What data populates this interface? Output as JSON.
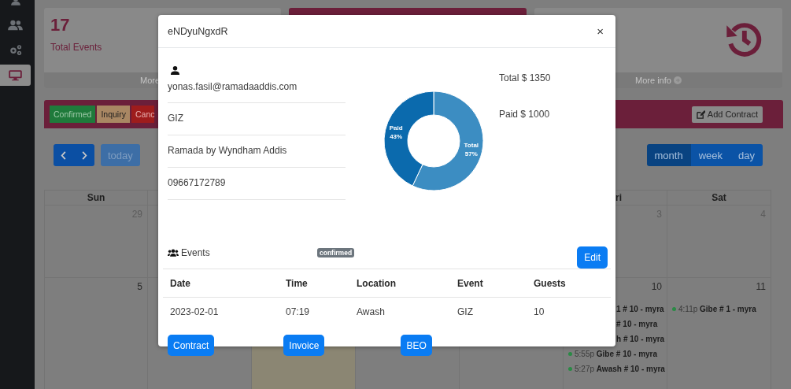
{
  "sidebar": {
    "items": [
      {
        "selected": false
      },
      {
        "selected": false
      },
      {
        "selected": false
      },
      {
        "selected": true
      }
    ]
  },
  "stat_cards": [
    {
      "kind": "count",
      "value": "17",
      "label": "Total Events",
      "footer": "More"
    },
    {
      "kind": "blank"
    },
    {
      "kind": "icon",
      "footer": "More info"
    }
  ],
  "contract_bar": {
    "statuses": [
      {
        "label": "Confirmed",
        "color": "#1f7a3b"
      },
      {
        "label": "Inquiry",
        "color": "#a98763"
      },
      {
        "label": "Canc",
        "color": "#9e1c1c"
      }
    ],
    "add_button": "Add Contract"
  },
  "toolbar": {
    "today": "today",
    "views": [
      {
        "label": "month",
        "selected": true
      },
      {
        "label": "week",
        "selected": false
      },
      {
        "label": "day",
        "selected": false
      }
    ]
  },
  "calendar": {
    "weekdays": [
      {
        "label": "Sun",
        "kind": "full"
      },
      {
        "label": "ri",
        "kind": "cut"
      },
      {
        "label": "Sat",
        "kind": "full"
      }
    ],
    "weeks": [
      [
        {
          "date": "29",
          "today": false
        },
        {
          "date": "3",
          "today": false
        },
        {
          "date": "4",
          "today": false
        }
      ],
      [
        {
          "date": "5",
          "today": false
        },
        {
          "today": false
        },
        {
          "today": true
        },
        {
          "today": false
        },
        {
          "today": false
        },
        {
          "date": "10",
          "today": false,
          "events": [
            {
              "kind": "cut",
              "title": "1 # 10 - myra"
            },
            {
              "kind": "cut",
              "title": "# 10 - myra"
            },
            {
              "kind": "cut",
              "title": "h # 10 - myra"
            },
            {
              "kind": "full",
              "time": "5:55p",
              "title": "Gibe # 10 - myra",
              "color": "#2a8a45"
            },
            {
              "kind": "full",
              "time": "5:27p",
              "title": "Awash # 10 - myra",
              "color": "#2a8a45"
            }
          ]
        },
        {
          "date": "11",
          "today": false,
          "events": [
            {
              "kind": "full",
              "time": "4:11p",
              "title": "Gibe # 1 - myra",
              "color": "#2a8a45"
            }
          ]
        }
      ]
    ]
  },
  "modal": {
    "title": "eNDyuNgxdR",
    "close": "×",
    "contact": [
      "yonas.fasil@ramadaaddis.com",
      "GIZ",
      "Ramada by Wyndham Addis",
      "09667172789"
    ],
    "totals": [
      "Total $ 1350",
      "Paid $ 1000"
    ],
    "chart_data": {
      "type": "donut",
      "categories": [
        "Paid",
        "Total"
      ],
      "values": [
        43,
        57
      ],
      "value_labels": [
        "43%",
        "57%"
      ]
    },
    "events_label": "Events",
    "status_badge": "confirmed",
    "edit_button": "Edit",
    "table": {
      "columns": [
        "Date",
        "Time",
        "Location",
        "Event",
        "Guests"
      ],
      "rows": [
        [
          "2023-02-01",
          "07:19",
          "Awash",
          "GIZ",
          "10"
        ]
      ]
    },
    "buttons": [
      "Contract",
      "Invoice",
      "BEO"
    ]
  }
}
